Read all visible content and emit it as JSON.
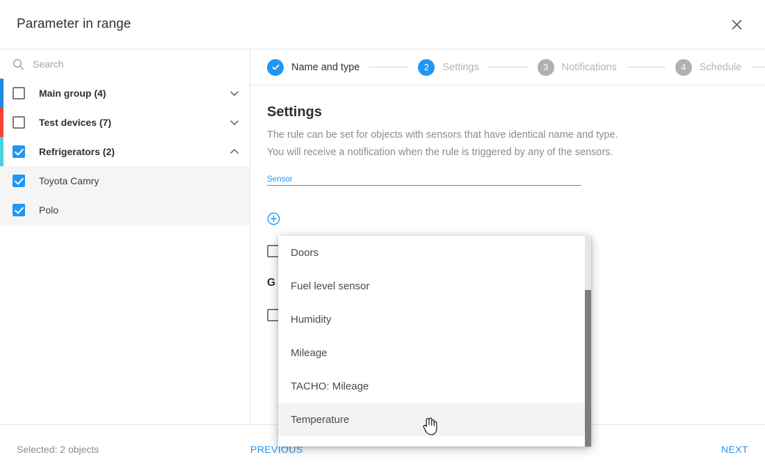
{
  "header": {
    "title": "Parameter in range",
    "close_icon": "close-icon"
  },
  "sidebar": {
    "search": {
      "placeholder": "Search",
      "value": "",
      "icon": "search-icon"
    },
    "tree": [
      {
        "label": "Main group (4)",
        "checked": false,
        "expanded": false,
        "is_group": true,
        "bar_color": "#1e88e5",
        "chevron": "chevron-down-icon",
        "highlight": false
      },
      {
        "label": "Test devices (7)",
        "checked": false,
        "expanded": false,
        "is_group": true,
        "bar_color": "#f44336",
        "chevron": "chevron-down-icon",
        "highlight": false
      },
      {
        "label": "Refrigerators (2)",
        "checked": true,
        "expanded": true,
        "is_group": true,
        "bar_color": "#4dd0e1",
        "chevron": "chevron-up-icon",
        "highlight": false
      },
      {
        "label": "Toyota Camry",
        "checked": true,
        "is_group": false,
        "bar_color": "",
        "chevron": "",
        "highlight": true
      },
      {
        "label": "Polo",
        "checked": true,
        "is_group": false,
        "bar_color": "",
        "chevron": "",
        "highlight": true
      }
    ]
  },
  "stepper": {
    "steps": [
      {
        "marker": "✓",
        "label": "Name and type",
        "state": "done"
      },
      {
        "marker": "2",
        "label": "Settings",
        "state": "active"
      },
      {
        "marker": "3",
        "label": "Notifications",
        "state": "todo"
      },
      {
        "marker": "4",
        "label": "Schedule",
        "state": "todo"
      }
    ]
  },
  "content": {
    "title": "Settings",
    "description_line1": "The rule can be set for objects with sensors that have identical name and type.",
    "description_line2": "You will receive a notification when the rule is triggered by any of the sensors.",
    "sensor_field": {
      "label": "Sensor",
      "value": "",
      "accent_color": "#2196f3"
    },
    "add_condition_label": "",
    "add_condition_icon": "plus-circle-icon",
    "checkbox_one_label": "",
    "section_heading": "G",
    "checkbox_two_label": ""
  },
  "dropdown": {
    "options": [
      {
        "label": "Doors",
        "highlighted": false
      },
      {
        "label": "Fuel level sensor",
        "highlighted": false
      },
      {
        "label": "Humidity",
        "highlighted": false
      },
      {
        "label": "Mileage",
        "highlighted": false
      },
      {
        "label": "TACHO: Mileage",
        "highlighted": false
      },
      {
        "label": "Temperature",
        "highlighted": true
      }
    ],
    "scrollbar": "vertical-scrollbar"
  },
  "footer": {
    "selected_text": "Selected: 2 objects",
    "previous_label": "PREVIOUS",
    "next_label": "NEXT"
  },
  "cursor": {
    "type": "pointer-hand-cursor"
  },
  "colors": {
    "accent": "#2196f3",
    "text": "#3b3b3b",
    "muted": "#8b8b8b",
    "border": "#e4e6e8",
    "highlight_row": "#f5f5f5"
  }
}
